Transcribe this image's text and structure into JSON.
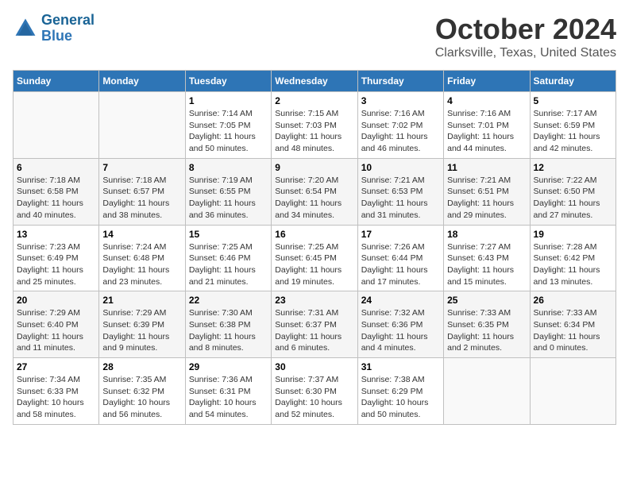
{
  "header": {
    "logo_line1": "General",
    "logo_line2": "Blue",
    "month": "October 2024",
    "location": "Clarksville, Texas, United States"
  },
  "days_of_week": [
    "Sunday",
    "Monday",
    "Tuesday",
    "Wednesday",
    "Thursday",
    "Friday",
    "Saturday"
  ],
  "weeks": [
    [
      {
        "day": "",
        "info": ""
      },
      {
        "day": "",
        "info": ""
      },
      {
        "day": "1",
        "info": "Sunrise: 7:14 AM\nSunset: 7:05 PM\nDaylight: 11 hours and 50 minutes."
      },
      {
        "day": "2",
        "info": "Sunrise: 7:15 AM\nSunset: 7:03 PM\nDaylight: 11 hours and 48 minutes."
      },
      {
        "day": "3",
        "info": "Sunrise: 7:16 AM\nSunset: 7:02 PM\nDaylight: 11 hours and 46 minutes."
      },
      {
        "day": "4",
        "info": "Sunrise: 7:16 AM\nSunset: 7:01 PM\nDaylight: 11 hours and 44 minutes."
      },
      {
        "day": "5",
        "info": "Sunrise: 7:17 AM\nSunset: 6:59 PM\nDaylight: 11 hours and 42 minutes."
      }
    ],
    [
      {
        "day": "6",
        "info": "Sunrise: 7:18 AM\nSunset: 6:58 PM\nDaylight: 11 hours and 40 minutes."
      },
      {
        "day": "7",
        "info": "Sunrise: 7:18 AM\nSunset: 6:57 PM\nDaylight: 11 hours and 38 minutes."
      },
      {
        "day": "8",
        "info": "Sunrise: 7:19 AM\nSunset: 6:55 PM\nDaylight: 11 hours and 36 minutes."
      },
      {
        "day": "9",
        "info": "Sunrise: 7:20 AM\nSunset: 6:54 PM\nDaylight: 11 hours and 34 minutes."
      },
      {
        "day": "10",
        "info": "Sunrise: 7:21 AM\nSunset: 6:53 PM\nDaylight: 11 hours and 31 minutes."
      },
      {
        "day": "11",
        "info": "Sunrise: 7:21 AM\nSunset: 6:51 PM\nDaylight: 11 hours and 29 minutes."
      },
      {
        "day": "12",
        "info": "Sunrise: 7:22 AM\nSunset: 6:50 PM\nDaylight: 11 hours and 27 minutes."
      }
    ],
    [
      {
        "day": "13",
        "info": "Sunrise: 7:23 AM\nSunset: 6:49 PM\nDaylight: 11 hours and 25 minutes."
      },
      {
        "day": "14",
        "info": "Sunrise: 7:24 AM\nSunset: 6:48 PM\nDaylight: 11 hours and 23 minutes."
      },
      {
        "day": "15",
        "info": "Sunrise: 7:25 AM\nSunset: 6:46 PM\nDaylight: 11 hours and 21 minutes."
      },
      {
        "day": "16",
        "info": "Sunrise: 7:25 AM\nSunset: 6:45 PM\nDaylight: 11 hours and 19 minutes."
      },
      {
        "day": "17",
        "info": "Sunrise: 7:26 AM\nSunset: 6:44 PM\nDaylight: 11 hours and 17 minutes."
      },
      {
        "day": "18",
        "info": "Sunrise: 7:27 AM\nSunset: 6:43 PM\nDaylight: 11 hours and 15 minutes."
      },
      {
        "day": "19",
        "info": "Sunrise: 7:28 AM\nSunset: 6:42 PM\nDaylight: 11 hours and 13 minutes."
      }
    ],
    [
      {
        "day": "20",
        "info": "Sunrise: 7:29 AM\nSunset: 6:40 PM\nDaylight: 11 hours and 11 minutes."
      },
      {
        "day": "21",
        "info": "Sunrise: 7:29 AM\nSunset: 6:39 PM\nDaylight: 11 hours and 9 minutes."
      },
      {
        "day": "22",
        "info": "Sunrise: 7:30 AM\nSunset: 6:38 PM\nDaylight: 11 hours and 8 minutes."
      },
      {
        "day": "23",
        "info": "Sunrise: 7:31 AM\nSunset: 6:37 PM\nDaylight: 11 hours and 6 minutes."
      },
      {
        "day": "24",
        "info": "Sunrise: 7:32 AM\nSunset: 6:36 PM\nDaylight: 11 hours and 4 minutes."
      },
      {
        "day": "25",
        "info": "Sunrise: 7:33 AM\nSunset: 6:35 PM\nDaylight: 11 hours and 2 minutes."
      },
      {
        "day": "26",
        "info": "Sunrise: 7:33 AM\nSunset: 6:34 PM\nDaylight: 11 hours and 0 minutes."
      }
    ],
    [
      {
        "day": "27",
        "info": "Sunrise: 7:34 AM\nSunset: 6:33 PM\nDaylight: 10 hours and 58 minutes."
      },
      {
        "day": "28",
        "info": "Sunrise: 7:35 AM\nSunset: 6:32 PM\nDaylight: 10 hours and 56 minutes."
      },
      {
        "day": "29",
        "info": "Sunrise: 7:36 AM\nSunset: 6:31 PM\nDaylight: 10 hours and 54 minutes."
      },
      {
        "day": "30",
        "info": "Sunrise: 7:37 AM\nSunset: 6:30 PM\nDaylight: 10 hours and 52 minutes."
      },
      {
        "day": "31",
        "info": "Sunrise: 7:38 AM\nSunset: 6:29 PM\nDaylight: 10 hours and 50 minutes."
      },
      {
        "day": "",
        "info": ""
      },
      {
        "day": "",
        "info": ""
      }
    ]
  ]
}
